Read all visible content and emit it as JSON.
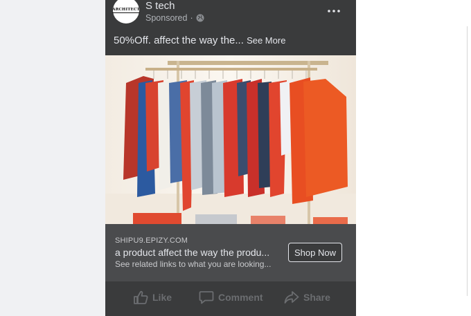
{
  "post": {
    "page_name": "S tech",
    "sponsored": "Sponsored",
    "separator": "·",
    "avatar_text": "ARCHITECT",
    "caption": "50%Off. affect the way the...",
    "see_more": "See More",
    "link": {
      "domain": "SHIPU9.EPIZY.COM",
      "title": "a product affect the way the produ...",
      "description": "See related links to what you are looking...",
      "cta": "Shop Now"
    },
    "actions": {
      "like": "Like",
      "comment": "Comment",
      "share": "Share"
    }
  },
  "colors": {
    "card_background": "#3a3b3c",
    "link_bar_background": "#4a4b4d",
    "text_primary": "#e4e6eb",
    "text_secondary": "#b0b3b8",
    "action_muted": "#6b6d70"
  },
  "icons": [
    "globe-icon",
    "more-options-icon",
    "like-icon",
    "comment-icon",
    "share-icon"
  ]
}
